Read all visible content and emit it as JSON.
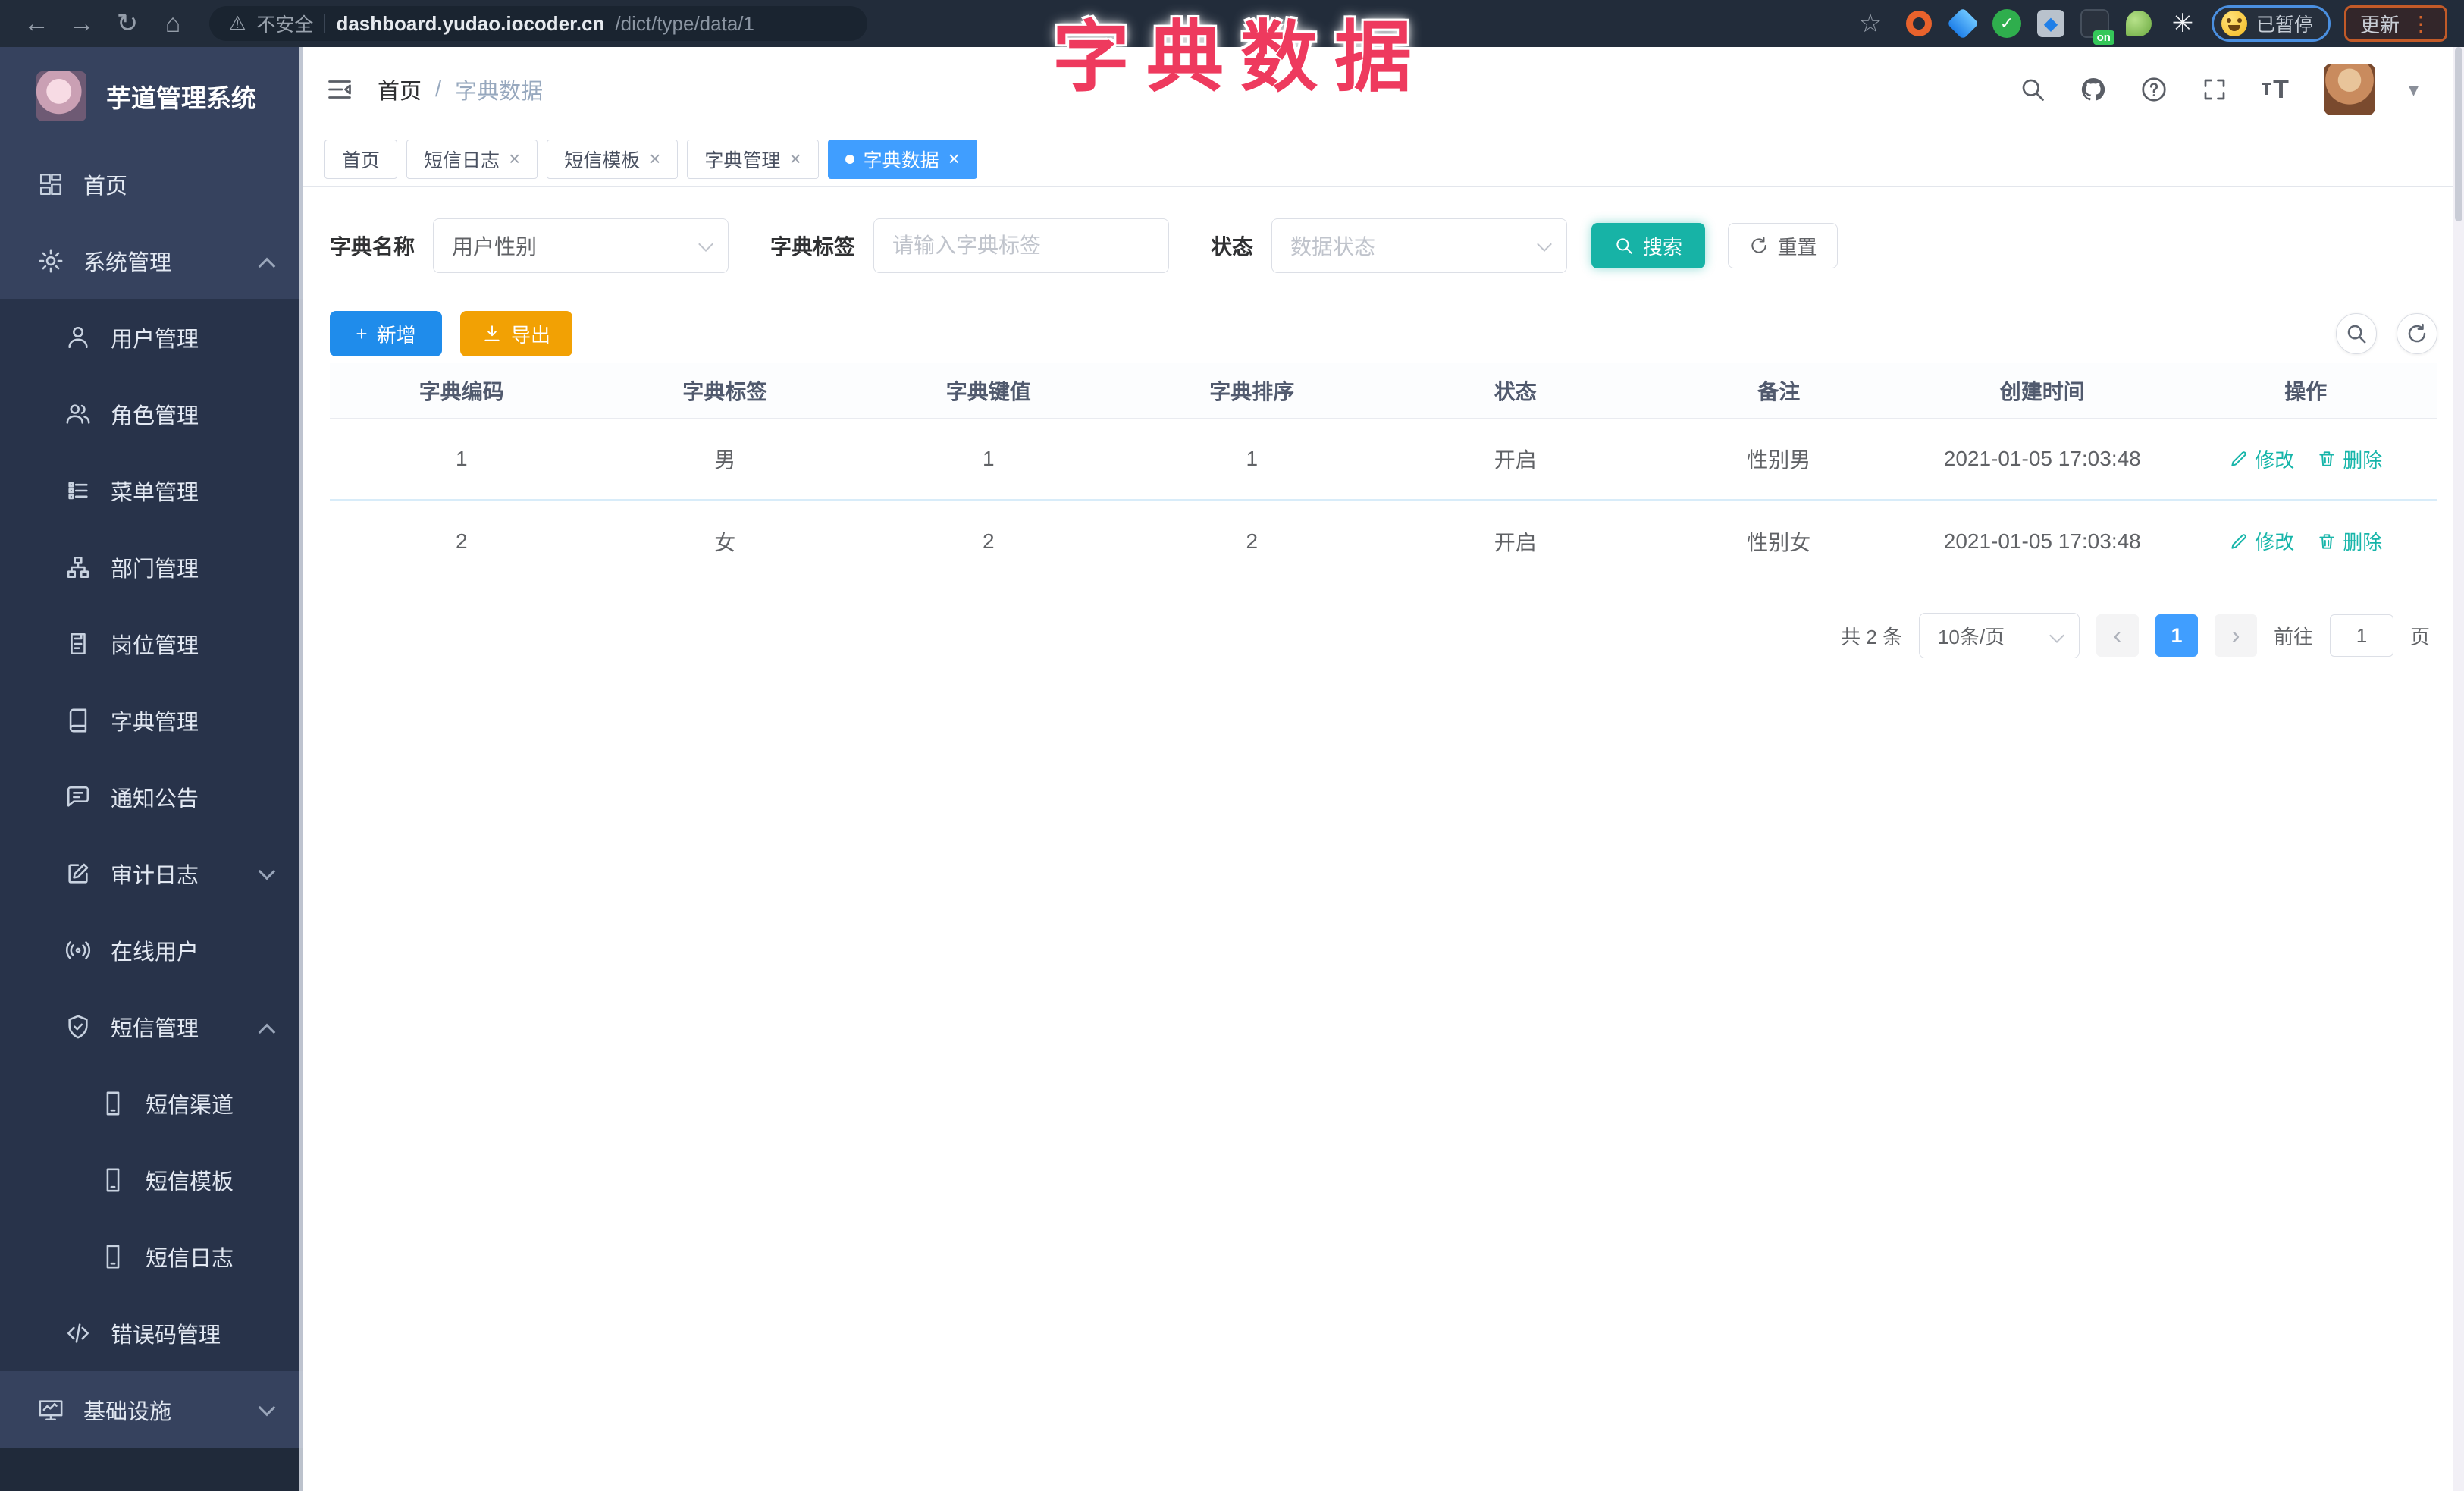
{
  "browser": {
    "security_label": "不安全",
    "url_domain": "dashboard.yudao.iocoder.cn",
    "url_path": "/dict/type/data/1",
    "extension_badge": "on",
    "paused_label": "已暂停",
    "update_label": "更新"
  },
  "overlay_title": "字典数据",
  "sidebar": {
    "app_title": "芋道管理系统",
    "items": [
      {
        "label": "首页",
        "icon": "dashboard-icon"
      },
      {
        "label": "系统管理",
        "icon": "gear-icon"
      },
      {
        "label": "用户管理",
        "icon": "user-icon"
      },
      {
        "label": "角色管理",
        "icon": "users-icon"
      },
      {
        "label": "菜单管理",
        "icon": "menu-list-icon"
      },
      {
        "label": "部门管理",
        "icon": "org-tree-icon"
      },
      {
        "label": "岗位管理",
        "icon": "badge-icon"
      },
      {
        "label": "字典管理",
        "icon": "dict-book-icon"
      },
      {
        "label": "通知公告",
        "icon": "announcement-icon"
      },
      {
        "label": "审计日志",
        "icon": "audit-log-icon"
      },
      {
        "label": "在线用户",
        "icon": "online-user-icon"
      },
      {
        "label": "短信管理",
        "icon": "sms-shield-icon"
      },
      {
        "label": "短信渠道",
        "icon": "phone-icon"
      },
      {
        "label": "短信模板",
        "icon": "phone-icon"
      },
      {
        "label": "短信日志",
        "icon": "phone-icon"
      },
      {
        "label": "错误码管理",
        "icon": "code-icon"
      },
      {
        "label": "基础设施",
        "icon": "infrastructure-icon"
      }
    ]
  },
  "navbar": {
    "breadcrumb": {
      "home": "首页",
      "separator": "/",
      "current": "字典数据"
    }
  },
  "tabs": [
    {
      "label": "首页",
      "closable": false,
      "active": false
    },
    {
      "label": "短信日志",
      "closable": true,
      "active": false
    },
    {
      "label": "短信模板",
      "closable": true,
      "active": false
    },
    {
      "label": "字典管理",
      "closable": true,
      "active": false
    },
    {
      "label": "字典数据",
      "closable": true,
      "active": true
    }
  ],
  "filter": {
    "dict_name_label": "字典名称",
    "dict_name_value": "用户性别",
    "dict_label_label": "字典标签",
    "dict_label_placeholder": "请输入字典标签",
    "status_label": "状态",
    "status_placeholder": "数据状态",
    "search_label": "搜索",
    "reset_label": "重置"
  },
  "toolbar": {
    "add_label": "新增",
    "export_label": "导出"
  },
  "table": {
    "headers": [
      "字典编码",
      "字典标签",
      "字典键值",
      "字典排序",
      "状态",
      "备注",
      "创建时间",
      "操作"
    ],
    "rows": [
      {
        "code": "1",
        "label": "男",
        "value": "1",
        "sort": "1",
        "status": "开启",
        "remark": "性别男",
        "created": "2021-01-05 17:03:48"
      },
      {
        "code": "2",
        "label": "女",
        "value": "2",
        "sort": "2",
        "status": "开启",
        "remark": "性别女",
        "created": "2021-01-05 17:03:48"
      }
    ],
    "edit_label": "修改",
    "delete_label": "删除"
  },
  "pagination": {
    "total_text": "共 2 条",
    "page_size": "10条/页",
    "current_page": "1",
    "goto_label": "前往",
    "goto_value": "1",
    "page_unit": "页"
  },
  "colors": {
    "primary_blue": "#409eff",
    "teal_accent": "#17b3a6",
    "warning_orange": "#f2a104",
    "sidebar_bg": "#36425e",
    "submenu_bg": "#28334a",
    "annotation_red": "#ee3a5e"
  }
}
